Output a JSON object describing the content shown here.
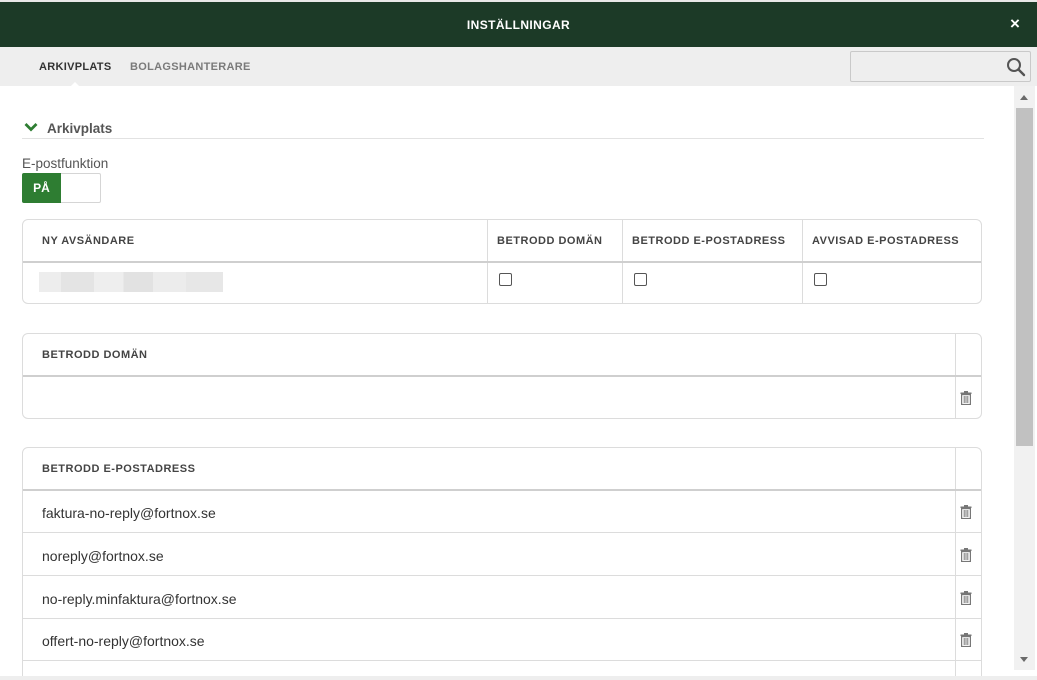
{
  "window": {
    "title": "INSTÄLLNINGAR",
    "close_label": "×"
  },
  "tabs": [
    {
      "label": "ARKIVPLATS",
      "active": true
    },
    {
      "label": "BOLAGSHANTERARE",
      "active": false
    }
  ],
  "search": {
    "placeholder": "",
    "value": ""
  },
  "section": {
    "title": "Arkivplats"
  },
  "email_function": {
    "label": "E-postfunktion",
    "toggle_label": "PÅ",
    "enabled": true
  },
  "sender_table": {
    "headers": [
      "NY AVSÄNDARE",
      "BETRODD DOMÄN",
      "BETRODD E-POSTADRESS",
      "AVVISAD E-POSTADRESS"
    ],
    "rows": [
      {
        "sender": "",
        "trusted_domain": false,
        "trusted_email": false,
        "rejected_email": false
      }
    ]
  },
  "trusted_domain_table": {
    "header": "BETRODD DOMÄN",
    "rows": [
      ""
    ]
  },
  "trusted_email_table": {
    "header": "BETRODD E-POSTADRESS",
    "rows": [
      "faktura-no-reply@fortnox.se",
      "noreply@fortnox.se",
      "no-reply.minfaktura@fortnox.se",
      "offert-no-reply@fortnox.se"
    ]
  },
  "colors": {
    "titlebar": "#1c3a27",
    "accent": "#2e7d32",
    "tabbar": "#eeeeee"
  },
  "icons": {
    "close": "close-icon",
    "search": "search-icon",
    "chevron": "chevron-down-icon",
    "delete": "trash-icon"
  }
}
